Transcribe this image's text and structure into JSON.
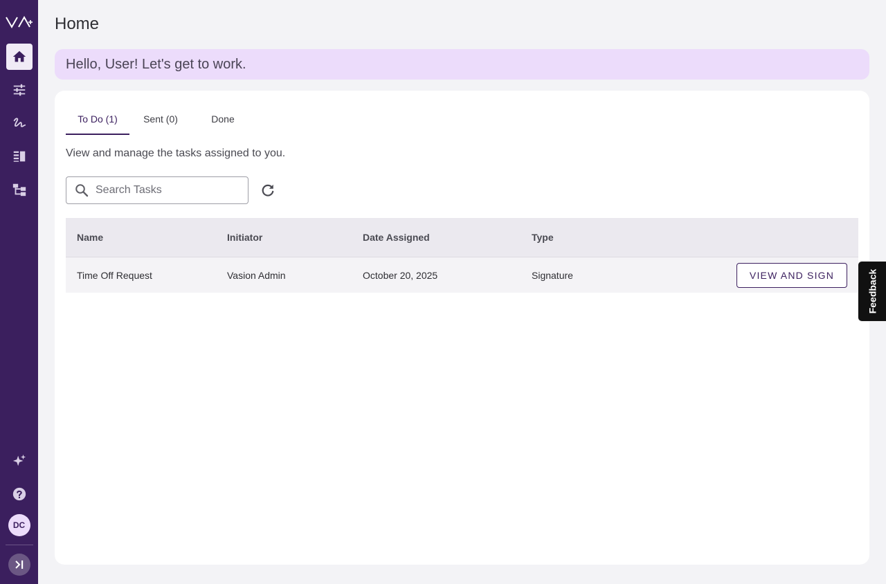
{
  "page": {
    "title": "Home"
  },
  "greeting": "Hello, User! Let's get to work.",
  "sidebar": {
    "logo_icon": "vasion-logo-icon",
    "items": [
      {
        "name": "home",
        "icon": "home-icon",
        "active": true
      },
      {
        "name": "settings",
        "icon": "sliders-icon",
        "active": false
      },
      {
        "name": "signature",
        "icon": "signature-icon",
        "active": false
      },
      {
        "name": "library",
        "icon": "library-icon",
        "active": false
      },
      {
        "name": "workflow",
        "icon": "workflow-icon",
        "active": false
      }
    ],
    "bottom": {
      "ai_icon": "sparkle-icon",
      "help_icon": "help-icon",
      "avatar_initials": "DC",
      "collapse_icon": "expand-icon"
    }
  },
  "tabs": [
    {
      "label": "To Do (1)",
      "active": true
    },
    {
      "label": "Sent (0)",
      "active": false
    },
    {
      "label": "Done",
      "active": false
    }
  ],
  "subtitle": "View and manage the tasks assigned to you.",
  "search": {
    "placeholder": "Search Tasks",
    "value": ""
  },
  "table": {
    "columns": [
      "Name",
      "Initiator",
      "Date Assigned",
      "Type"
    ],
    "rows": [
      {
        "name": "Time Off Request",
        "initiator": "Vasion Admin",
        "date": "October 20, 2025",
        "type": "Signature",
        "action": "VIEW AND SIGN"
      }
    ]
  },
  "feedback_label": "Feedback",
  "colors": {
    "sidebar": "#3b1f5e",
    "accent": "#3b1f5e",
    "greeting_bg": "#ecdcfb",
    "background": "#f3f3f6"
  }
}
